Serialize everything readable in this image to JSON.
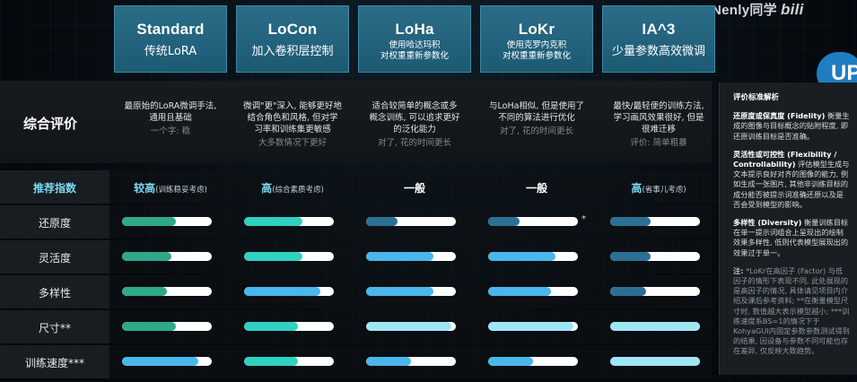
{
  "watermark": {
    "text": "Nenly同学",
    "logo": "bili"
  },
  "badge": "UP",
  "columns": [
    {
      "name": "Standard",
      "sub": "传统LoRA",
      "sub_size": "big"
    },
    {
      "name": "LoCon",
      "sub": "加入卷积层控制",
      "sub_size": "big"
    },
    {
      "name": "LoHa",
      "sub": "使用哈达玛积\n对权重重新参数化",
      "sub_size": "small"
    },
    {
      "name": "LoKr",
      "sub": "使用克罗内克积\n对权重重新参数化",
      "sub_size": "small"
    },
    {
      "name": "IA^3",
      "sub": "少量参数高效微调",
      "sub_size": "big"
    }
  ],
  "overall": {
    "label": "综合评价",
    "cells": [
      {
        "text": "最原始的LoRA微调手法,\n通用且基础",
        "note": "一个字: 稳"
      },
      {
        "text": "微调\"更\"深入, 能够更好地\n结合角色和风格, 但对学\n习率和训练集更敏感",
        "note": "大多数情况下更好"
      },
      {
        "text": "适合较简单的概念或多\n概念训练, 可以追求更好\n的泛化能力",
        "note": "对了, 花的时间更长"
      },
      {
        "text": "与LoHa相似, 但是使用了\n不同的算法进行优化",
        "note": "对了, 花的时间更长"
      },
      {
        "text": "最快/最轻便的训练方法,\n学习画风效果很好, 但是\n很难迁移",
        "note": "评价: 简单粗暴"
      }
    ]
  },
  "recommend": {
    "label": "推荐指数",
    "cells": [
      {
        "main": "较高",
        "small": "(训练稳妥考虑)",
        "highlight": true
      },
      {
        "main": "高",
        "small": "(综合素质考虑)",
        "highlight": true
      },
      {
        "main": "一般",
        "small": "",
        "highlight": false
      },
      {
        "main": "一般",
        "small": "",
        "highlight": false
      },
      {
        "main": "高",
        "small": "(省事儿考虑)",
        "highlight": true
      }
    ]
  },
  "metrics": [
    {
      "label": "还原度",
      "values": [
        0.6,
        0.65,
        0.35,
        0.35,
        0.45
      ],
      "colors": [
        "#2fa889",
        "#2fd1c0",
        "#2c6f95",
        "#2c6f95",
        "#2c6f95"
      ],
      "star_after": 3
    },
    {
      "label": "灵活度",
      "values": [
        0.55,
        0.65,
        0.75,
        0.75,
        0.45
      ],
      "colors": [
        "#2fa889",
        "#2fd1c0",
        "#49b6ec",
        "#49b6ec",
        "#2c6f95"
      ],
      "star_after": -1
    },
    {
      "label": "多样性",
      "values": [
        0.5,
        0.85,
        0.75,
        0.7,
        0.4
      ],
      "colors": [
        "#2fa889",
        "#49b6ec",
        "#49b6ec",
        "#49b6ec",
        "#2c6f95"
      ],
      "star_after": -1
    },
    {
      "label": "尺寸**",
      "values": [
        0.6,
        0.6,
        0.95,
        0.95,
        1.0
      ],
      "colors": [
        "#2fa889",
        "#2fd1c0",
        "#9ee6f4",
        "#9ee6f4",
        "#9ee6f4"
      ],
      "star_after": -1
    },
    {
      "label": "训练速度***",
      "values": [
        0.85,
        0.6,
        0.5,
        0.5,
        1.0
      ],
      "colors": [
        "#49b6ec",
        "#2fd1c0",
        "#49b6ec",
        "#49b6ec",
        "#9ee6f4"
      ],
      "star_after": -1
    }
  ],
  "star_mark": "*",
  "criteria": {
    "title": "评价标准解析",
    "items": [
      {
        "term": "还原度或保真度 (Fidelity)",
        "desc": "衡量生成的图像与目标概念的贴附程度, 即还原训练目标是否准确。"
      },
      {
        "term": "灵活性或可控性 (Flexibility / Controllability)",
        "desc": "评估模型生成与文本提示良好对齐的图像的能力, 例如生成一张图片, 其他非训练目标的成分能否被提示词准确还原以及是否会受到模型的影响。"
      },
      {
        "term": "多样性 (Diversity)",
        "desc": "衡量训练目标在单一提示词组合上呈现出的绘制效果多样性, 低则代表模型展现出的效果过于单一。"
      }
    ],
    "note_label": "注:",
    "note": "*LoKr在高因子 (Factor) 与低因子的情形下表现不同, 此处展现的是高因子的情况, 具体请见项目内介绍及课后参考资料; **在衡量模型尺寸时, 数值越大表示模型越小; ***训练速度系BS=1的情况下于KohyaGUI内固定参数参数测试得到的结果, 因设备与参数不同可能也存在差异, 仅反映大致趋势。"
  }
}
